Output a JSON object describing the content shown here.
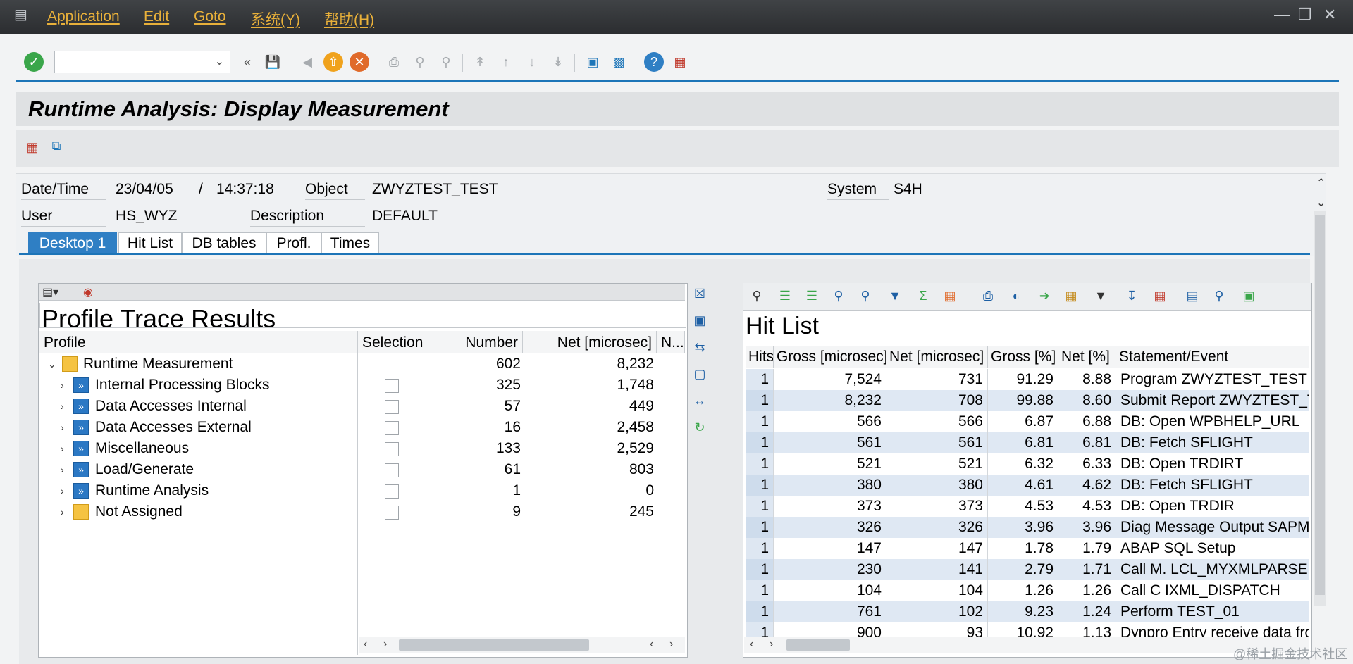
{
  "menu": {
    "items": [
      "Application",
      "Edit",
      "Goto",
      "系统(Y)",
      "帮助(H)"
    ]
  },
  "toolbar": {
    "command_field": "",
    "icons": [
      "enter-icon",
      "back-double-icon",
      "save-icon",
      "back-icon",
      "exit-icon",
      "cancel-icon",
      "print-icon",
      "find-icon",
      "find-next-icon",
      "first-page-icon",
      "prev-page-icon",
      "next-page-icon",
      "last-page-icon",
      "new-session-icon",
      "shortcut-icon",
      "help-icon",
      "customize-layout-icon"
    ]
  },
  "title": "Runtime Analysis: Display Measurement",
  "header": {
    "datetime_label": "Date/Time",
    "date": "23/04/05",
    "slash": "/",
    "time": "14:37:18",
    "object_label": "Object",
    "object": "ZWYZTEST_TEST",
    "system_label": "System",
    "system": "S4H",
    "user_label": "User",
    "user": "HS_WYZ",
    "description_label": "Description",
    "description": "DEFAULT"
  },
  "tabs": [
    "Desktop 1",
    "Hit List",
    "DB tables",
    "Profl.",
    "Times"
  ],
  "tree": {
    "title": "Profile Trace Results",
    "columns": [
      "Profile",
      "Selection",
      "Number",
      "Net [microsec]",
      "N..."
    ],
    "root": {
      "name": "Runtime Measurement",
      "number": "602",
      "net": "8,232"
    },
    "rows": [
      {
        "name": "Internal Processing Blocks",
        "number": "325",
        "net": "1,748"
      },
      {
        "name": "Data Accesses Internal",
        "number": "57",
        "net": "449"
      },
      {
        "name": "Data Accesses External",
        "number": "16",
        "net": "2,458"
      },
      {
        "name": "Miscellaneous",
        "number": "133",
        "net": "2,529"
      },
      {
        "name": "Load/Generate",
        "number": "61",
        "net": "803"
      },
      {
        "name": "Runtime Analysis",
        "number": "1",
        "net": "0"
      },
      {
        "name": "Not Assigned",
        "number": "9",
        "net": "245"
      }
    ]
  },
  "hitlist": {
    "title": "Hit List",
    "columns": [
      "Hits",
      "Gross [microsec]",
      "Net [microsec]",
      "Gross [%]",
      "Net [%]",
      "Statement/Event"
    ],
    "rows": [
      [
        "1",
        "7,524",
        "731",
        "91.29",
        "8.88",
        "Program ZWYZTEST_TEST"
      ],
      [
        "1",
        "8,232",
        "708",
        "99.88",
        "8.60",
        "Submit Report ZWYZTEST_TE"
      ],
      [
        "1",
        "566",
        "566",
        "6.87",
        "6.88",
        "DB: Open WPBHELP_URL"
      ],
      [
        "1",
        "561",
        "561",
        "6.81",
        "6.81",
        "DB: Fetch SFLIGHT"
      ],
      [
        "1",
        "521",
        "521",
        "6.32",
        "6.33",
        "DB: Open TRDIRT"
      ],
      [
        "1",
        "380",
        "380",
        "4.61",
        "4.62",
        "DB: Fetch SFLIGHT"
      ],
      [
        "1",
        "373",
        "373",
        "4.53",
        "4.53",
        "DB: Open TRDIR"
      ],
      [
        "1",
        "326",
        "326",
        "3.96",
        "3.96",
        "Diag Message Output SAPMS"
      ],
      [
        "1",
        "147",
        "147",
        "1.78",
        "1.79",
        "ABAP SQL Setup"
      ],
      [
        "1",
        "230",
        "141",
        "2.79",
        "1.71",
        "Call M. LCL_MYXMLPARSER="
      ],
      [
        "1",
        "104",
        "104",
        "1.26",
        "1.26",
        "Call C IXML_DISPATCH"
      ],
      [
        "1",
        "761",
        "102",
        "9.23",
        "1.24",
        "Perform TEST_01"
      ],
      [
        "1",
        "900",
        "93",
        "10.92",
        "1.13",
        "Dynpro Entry receive data fro"
      ]
    ]
  },
  "watermark": "@稀土掘金技术社区",
  "colors": {
    "menu_bg": "#2b2d30",
    "menu_text": "#e8b03a",
    "accent": "#1d75b8",
    "row_alt": "#dfe8f3"
  }
}
